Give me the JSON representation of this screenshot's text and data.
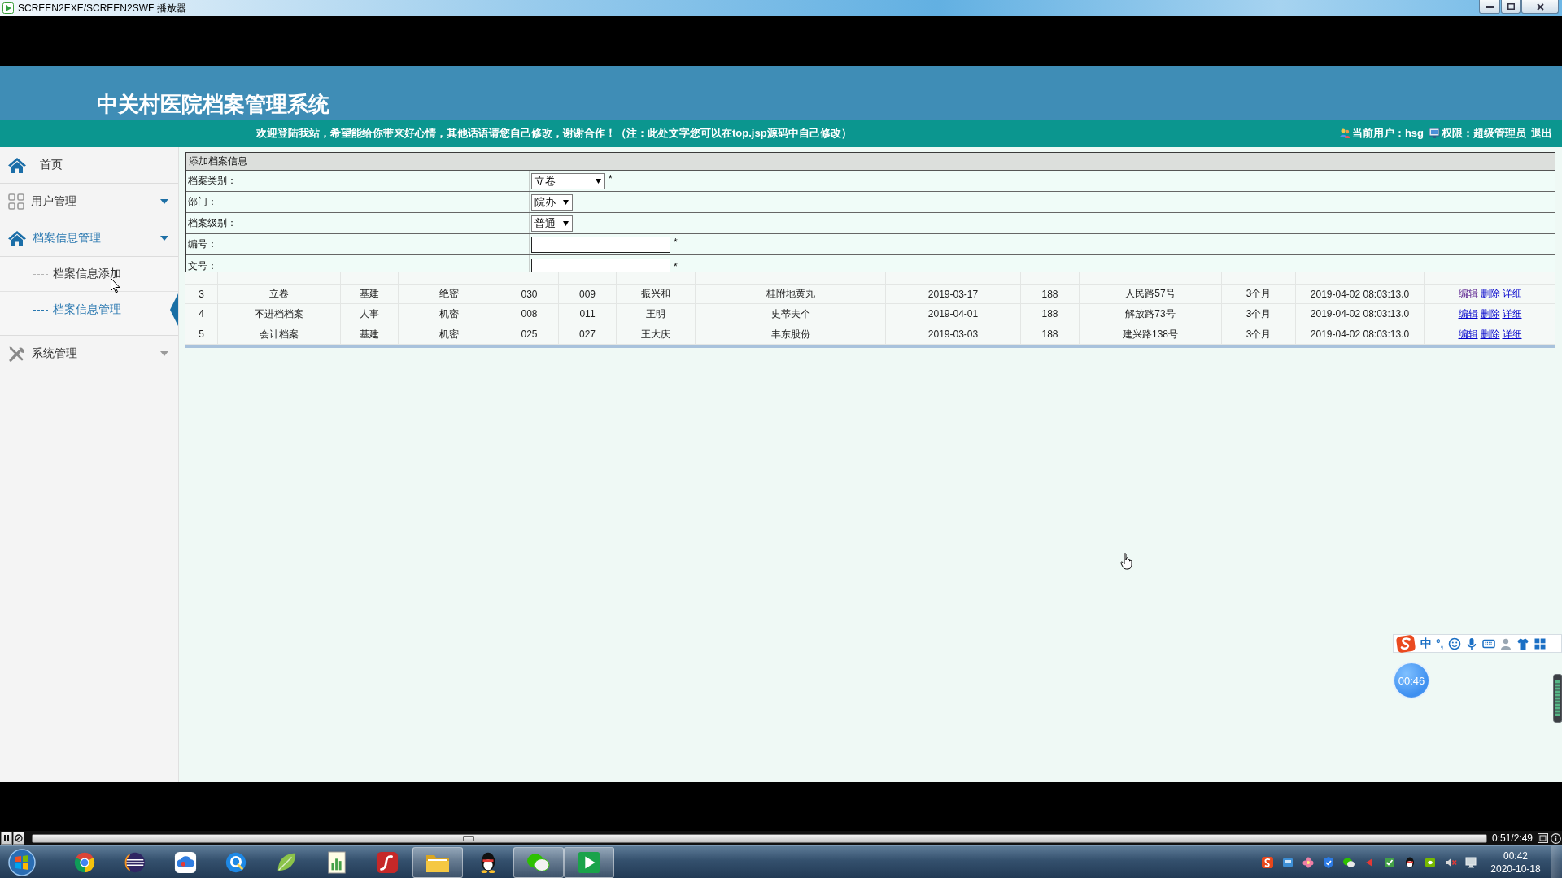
{
  "player_window": {
    "title": "SCREEN2EXE/SCREEN2SWF 播放器"
  },
  "header": {
    "title": "中关村医院档案管理系统",
    "notice": "欢迎登陆我站，希望能给你带来好心情，其他话语请您自己修改，谢谢合作！（注：此处文字您可以在top.jsp源码中自己修改）",
    "user": "当前用户：hsg",
    "role": "权限：超级管理员",
    "logout": "退出"
  },
  "sidebar": {
    "items": [
      {
        "label": "首页",
        "kind": "link",
        "expanded": false
      },
      {
        "label": "用户管理",
        "kind": "group",
        "expanded": false
      },
      {
        "label": "档案信息管理",
        "kind": "group",
        "expanded": true,
        "children": [
          {
            "label": "档案信息添加",
            "selected": false
          },
          {
            "label": "档案信息管理",
            "selected": true
          }
        ]
      },
      {
        "label": "系统管理",
        "kind": "group",
        "expanded": false
      }
    ]
  },
  "form": {
    "title": "添加档案信息",
    "fields": [
      {
        "kind": "select",
        "label": "档案类别：",
        "value": "立卷",
        "marker": "*"
      },
      {
        "kind": "select",
        "label": "部门：",
        "value": "院办"
      },
      {
        "kind": "select",
        "label": "档案级别：",
        "value": "普通"
      },
      {
        "kind": "input",
        "label": "编号：",
        "marker": "*"
      },
      {
        "kind": "input",
        "label": "文号：",
        "marker": "*"
      }
    ]
  },
  "table": {
    "rows": [
      {
        "cells": [
          "3",
          "立卷",
          "基建",
          "绝密",
          "030",
          "009",
          "振兴和",
          "桂附地黄丸",
          "2019-03-17",
          "188",
          "人民路57号",
          "3个月",
          "2019-04-02 08:03:13.0"
        ],
        "actions": [
          {
            "label": "编辑",
            "visited": true
          },
          {
            "label": "删除",
            "visited": false
          },
          {
            "label": "详细",
            "visited": false
          }
        ]
      },
      {
        "cells": [
          "4",
          "不进档档案",
          "人事",
          "机密",
          "008",
          "011",
          "王明",
          "史蒂夫个",
          "2019-04-01",
          "188",
          "解放路73号",
          "3个月",
          "2019-04-02 08:03:13.0"
        ],
        "actions": [
          {
            "label": "编辑",
            "visited": false
          },
          {
            "label": "删除",
            "visited": false
          },
          {
            "label": "详细",
            "visited": false
          }
        ]
      },
      {
        "cells": [
          "5",
          "会计档案",
          "基建",
          "机密",
          "025",
          "027",
          "王大庆",
          "丰东股份",
          "2019-03-03",
          "188",
          "建兴路138号",
          "3个月",
          "2019-04-02 08:03:13.0"
        ],
        "actions": [
          {
            "label": "编辑",
            "visited": false
          },
          {
            "label": "删除",
            "visited": false
          },
          {
            "label": "详细",
            "visited": false
          }
        ]
      }
    ]
  },
  "ime_toolbar": {
    "mode": "中",
    "punctuation": "°,"
  },
  "timer": {
    "time": "00:46"
  },
  "player": {
    "level": 0.3,
    "time": "0:51/2:49"
  },
  "taskbar": {
    "apps": [
      {
        "running": false
      },
      {
        "running": false
      },
      {
        "running": false
      },
      {
        "running": false
      },
      {
        "running": false
      },
      {
        "running": false
      },
      {
        "running": false
      },
      {
        "running": true
      },
      {
        "running": false
      },
      {
        "running": true
      },
      {
        "running": true
      }
    ],
    "clock": {
      "time": "00:42",
      "date": "2020-10-18"
    }
  }
}
